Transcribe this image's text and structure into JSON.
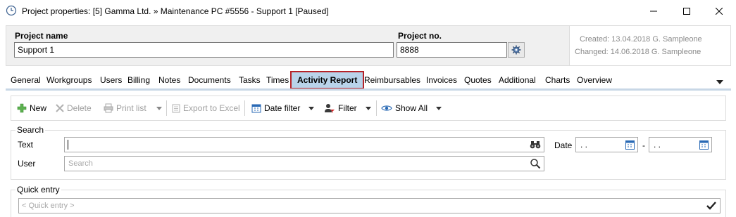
{
  "window": {
    "title": "Project properties: [5] Gamma Ltd. » Maintenance PC #5556 - Support 1 [Paused]"
  },
  "header": {
    "project_name_label": "Project name",
    "project_name_value": "Support 1",
    "project_no_label": "Project no.",
    "project_no_value": "8888",
    "created": "Created: 13.04.2018 G. Sampleone",
    "changed": "Changed: 14.06.2018 G. Sampleone"
  },
  "tabs": [
    {
      "label": "General"
    },
    {
      "label": "Workgroups"
    },
    {
      "label": "Users"
    },
    {
      "label": "Billing"
    },
    {
      "label": "Notes"
    },
    {
      "label": "Documents"
    },
    {
      "label": "Tasks"
    },
    {
      "label": "Times"
    },
    {
      "label": "Activity Report",
      "active": true
    },
    {
      "label": "Reimbursables"
    },
    {
      "label": "Invoices"
    },
    {
      "label": "Quotes"
    },
    {
      "label": "Additional"
    },
    {
      "label": "Charts"
    },
    {
      "label": "Overview"
    }
  ],
  "toolbar": {
    "new_label": "New",
    "delete_label": "Delete",
    "print_label": "Print list",
    "export_label": "Export to Excel",
    "date_filter_label": "Date filter",
    "filter_label": "Filter",
    "show_all_label": "Show All"
  },
  "search": {
    "group_title": "Search",
    "text_label": "Text",
    "text_value": "",
    "user_label": "User",
    "user_placeholder": "Search",
    "date_label": "Date",
    "date_from": " .  .",
    "date_to": " .  .",
    "date_separator": "-"
  },
  "quick_entry": {
    "group_title": "Quick entry",
    "placeholder": "< Quick entry >"
  },
  "colors": {
    "active_tab_bg": "#b9d3ea",
    "active_tab_border": "#b52228",
    "new_icon": "#4caf50",
    "calendar_icon": "#2a6ab5"
  },
  "icons": [
    "app-clock-icon",
    "minimize-icon",
    "maximize-icon",
    "close-icon",
    "gear-icon",
    "plus-icon",
    "delete-x-icon",
    "printer-icon",
    "export-excel-icon",
    "calendar-icon",
    "filter-person-icon",
    "eye-icon",
    "binoculars-icon",
    "magnifier-icon",
    "checkmark-icon",
    "chevron-down-icon"
  ]
}
